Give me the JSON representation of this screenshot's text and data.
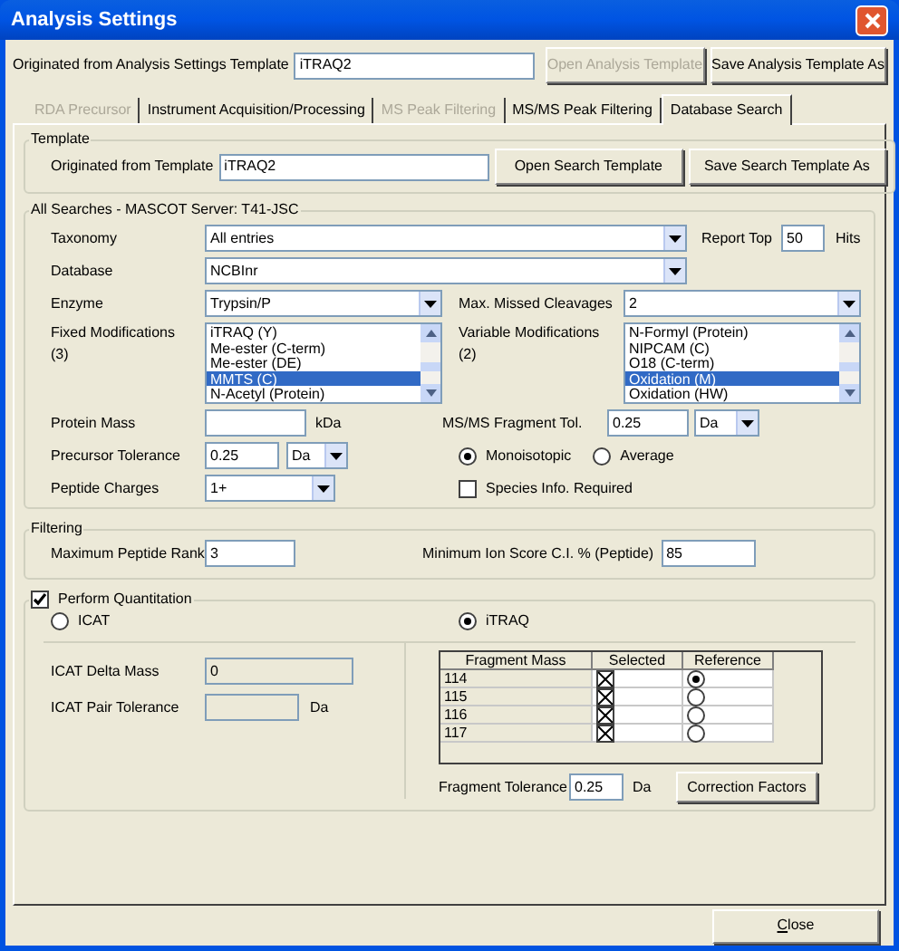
{
  "window": {
    "title": "Analysis Settings"
  },
  "template_bar": {
    "label": "Originated from Analysis Settings Template",
    "value": "iTRAQ2",
    "buttons": [
      {
        "label": "Open Analysis Template",
        "disabled": true
      },
      {
        "label": "Save Analysis Template As",
        "disabled": false
      }
    ]
  },
  "tabs": [
    {
      "label": "RDA Precursor",
      "selected": false,
      "disabled": true
    },
    {
      "label": "Instrument Acquisition/Processing",
      "selected": false,
      "disabled": false
    },
    {
      "label": "MS Peak Filtering",
      "selected": false,
      "disabled": true
    },
    {
      "label": "MS/MS Peak Filtering",
      "selected": false,
      "disabled": false
    },
    {
      "label": "Database Search",
      "selected": true,
      "disabled": false
    }
  ],
  "template_group": {
    "title": "Template",
    "label": "Originated from Template",
    "value": "iTRAQ2",
    "buttons": [
      "Open Search Template",
      "Save Search Template As"
    ]
  },
  "all_searches": {
    "title": "All Searches - MASCOT Server: T41-JSC",
    "taxonomy": {
      "label": "Taxonomy",
      "value": "All entries"
    },
    "report_top": {
      "label": "Report Top",
      "value": "50",
      "unit": "Hits"
    },
    "database": {
      "label": "Database",
      "value": "NCBInr"
    },
    "enzyme": {
      "label": "Enzyme",
      "value": "Trypsin/P"
    },
    "max_missed_cleavages": {
      "label": "Max. Missed Cleavages",
      "value": "2"
    },
    "fixed_modifications": {
      "label": "Fixed Modifications",
      "count": "(3)",
      "items": [
        {
          "label": "iTRAQ (Y)",
          "selected": false
        },
        {
          "label": "Me-ester (C-term)",
          "selected": false
        },
        {
          "label": "Me-ester (DE)",
          "selected": false
        },
        {
          "label": "MMTS (C)",
          "selected": true
        },
        {
          "label": "N-Acetyl (Protein)",
          "selected": false
        }
      ]
    },
    "variable_modifications": {
      "label": "Variable Modifications",
      "count": "(2)",
      "items": [
        {
          "label": "N-Formyl (Protein)",
          "selected": false
        },
        {
          "label": "NIPCAM (C)",
          "selected": false
        },
        {
          "label": "O18 (C-term)",
          "selected": false
        },
        {
          "label": "Oxidation (M)",
          "selected": true
        },
        {
          "label": "Oxidation (HW)",
          "selected": false
        }
      ]
    },
    "protein_mass": {
      "label": "Protein Mass",
      "unit": "kDa"
    },
    "ms_ms_fragment_tol": {
      "label": "MS/MS Fragment Tol.",
      "value": "0.25",
      "unit": "Da"
    },
    "precursor_tolerance": {
      "label": "Precursor Tolerance",
      "value": "0.25",
      "unit": "Da"
    },
    "mass_type": [
      {
        "label": "Monoisotopic",
        "selected": true
      },
      {
        "label": "Average",
        "selected": false
      }
    ],
    "peptide_charges": {
      "label": "Peptide Charges",
      "value": "1+"
    },
    "species_info": {
      "label": "Species Info. Required",
      "checked": false
    }
  },
  "filtering": {
    "title": "Filtering",
    "max_peptide_rank": {
      "label": "Maximum Peptide Rank",
      "value": "3"
    },
    "min_ion_score": {
      "label": "Minimum Ion Score C.I. % (Peptide)",
      "value": "85"
    }
  },
  "quantitation": {
    "label": "Perform Quantitation",
    "checked": true,
    "methods": [
      {
        "label": "ICAT",
        "selected": false
      },
      {
        "label": "iTRAQ",
        "selected": true
      }
    ],
    "icat_delta_mass": {
      "label": "ICAT Delta Mass",
      "value": "0",
      "disabled": true
    },
    "icat_pair_tolerance": {
      "label": "ICAT Pair Tolerance",
      "unit": "Da",
      "disabled": true
    },
    "table": {
      "columns": [
        "Fragment Mass",
        "Selected",
        "Reference"
      ],
      "rows": [
        {
          "mass": "114",
          "checked": true,
          "reference": true
        },
        {
          "mass": "115",
          "checked": true,
          "reference": false
        },
        {
          "mass": "116",
          "checked": true,
          "reference": false
        },
        {
          "mass": "117",
          "checked": true,
          "reference": false
        }
      ]
    },
    "fragment_tolerance": {
      "label": "Fragment Tolerance",
      "value": "0.25",
      "unit": "Da"
    },
    "correction_button": "Correction Factors"
  },
  "footer_buttons": [
    "Close"
  ]
}
